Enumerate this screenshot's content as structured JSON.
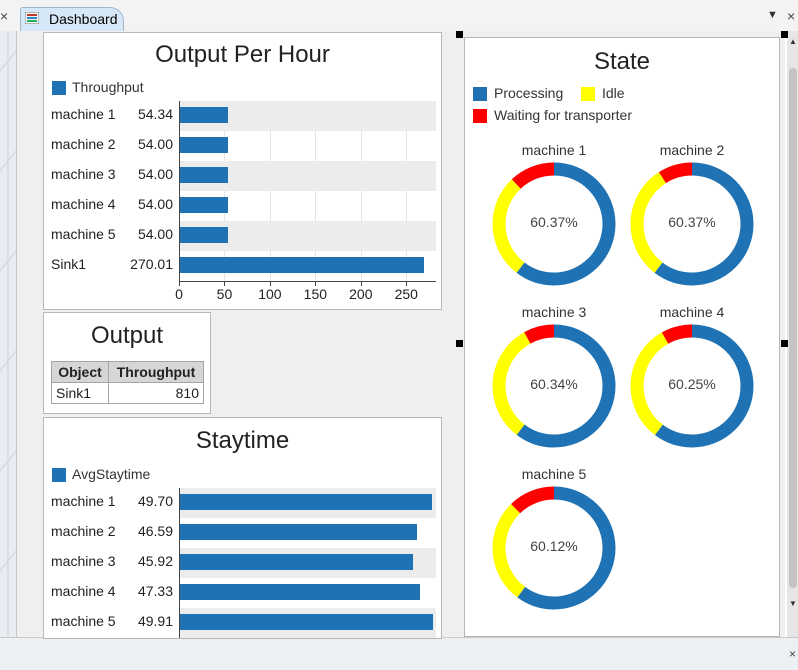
{
  "window": {
    "tab_label": "Dashboard",
    "tab_icon": "dashboard-icon",
    "close_glyph": "×",
    "dropdown_glyph": "▼",
    "scroll_up_glyph": "▲",
    "scroll_down_glyph": "▼"
  },
  "colors": {
    "bar": "#1f73b4",
    "processing": "#1f73b4",
    "idle": "#ffff00",
    "waiting": "#ff0000"
  },
  "output_per_hour": {
    "title": "Output Per Hour",
    "legend": "Throughput",
    "chart_data": {
      "type": "bar",
      "orientation": "horizontal",
      "categories": [
        "machine 1",
        "machine 2",
        "machine 3",
        "machine 4",
        "machine 5",
        "Sink1"
      ],
      "values": [
        54.34,
        54.0,
        54.0,
        54.0,
        54.0,
        270.01
      ],
      "value_labels": [
        "54.34",
        "54.00",
        "54.00",
        "54.00",
        "54.00",
        "270.01"
      ],
      "ticks": [
        0,
        50,
        100,
        150,
        200,
        250
      ],
      "tick_labels": [
        "0",
        "50",
        "100",
        "150",
        "200",
        "250"
      ],
      "xlim": [
        0,
        275
      ]
    }
  },
  "output": {
    "title": "Output",
    "headers": [
      "Object",
      "Throughput"
    ],
    "rows": [
      {
        "object": "Sink1",
        "throughput": "810"
      }
    ]
  },
  "staytime": {
    "title": "Staytime",
    "legend": "AvgStaytime",
    "chart_data": {
      "type": "bar",
      "orientation": "horizontal",
      "categories": [
        "machine 1",
        "machine 2",
        "machine 3",
        "machine 4",
        "machine 5"
      ],
      "values": [
        49.7,
        46.59,
        45.92,
        47.33,
        49.91
      ],
      "value_labels": [
        "49.70",
        "46.59",
        "45.92",
        "47.33",
        "49.91"
      ],
      "xlim": [
        0,
        51
      ]
    }
  },
  "state": {
    "title": "State",
    "legend": [
      {
        "label": "Processing",
        "color": "#1f73b4"
      },
      {
        "label": "Idle",
        "color": "#ffff00"
      },
      {
        "label": "Waiting for transporter",
        "color": "#ff0000"
      }
    ],
    "chart_data": {
      "type": "pie",
      "variant": "donut",
      "charts": [
        {
          "name": "machine 1",
          "label": "60.37%",
          "processing": 60.37,
          "idle": 27.5,
          "waiting": 12.13
        },
        {
          "name": "machine 2",
          "label": "60.37%",
          "processing": 60.37,
          "idle": 30.5,
          "waiting": 9.13
        },
        {
          "name": "machine 3",
          "label": "60.34%",
          "processing": 60.34,
          "idle": 31.5,
          "waiting": 8.16
        },
        {
          "name": "machine 4",
          "label": "60.25%",
          "processing": 60.25,
          "idle": 31.5,
          "waiting": 8.25
        },
        {
          "name": "machine 5",
          "label": "60.12%",
          "processing": 60.12,
          "idle": 27.5,
          "waiting": 12.38
        }
      ]
    }
  }
}
